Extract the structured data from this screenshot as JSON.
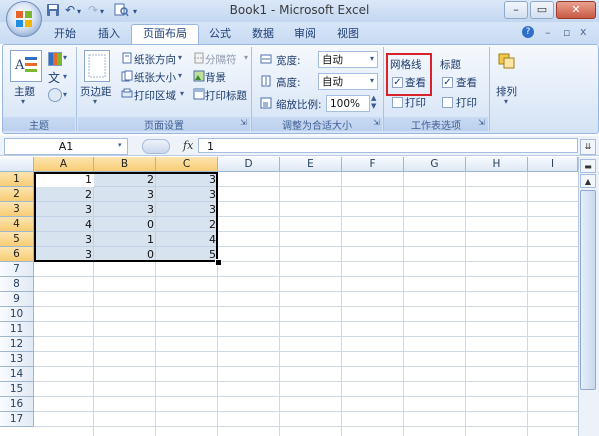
{
  "window": {
    "title": "Book1 - Microsoft Excel"
  },
  "tabs": [
    {
      "label": "开始"
    },
    {
      "label": "插入"
    },
    {
      "label": "页面布局"
    },
    {
      "label": "公式"
    },
    {
      "label": "数据"
    },
    {
      "label": "审阅"
    },
    {
      "label": "视图"
    }
  ],
  "ribbon": {
    "themes": {
      "label": "主题",
      "group": "主题"
    },
    "page_setup": {
      "margins": "页边距",
      "orientation": "纸张方向",
      "size": "纸张大小",
      "print_area": "打印区域",
      "breaks": "分隔符",
      "background": "背景",
      "print_titles": "打印标题",
      "group": "页面设置"
    },
    "scale": {
      "width_label": "宽度:",
      "width_value": "自动",
      "height_label": "高度:",
      "height_value": "自动",
      "scale_label": "缩放比例:",
      "scale_value": "100%",
      "group": "调整为合适大小"
    },
    "sheet_options": {
      "gridlines": "网格线",
      "headings": "标题",
      "view": "查看",
      "print": "打印",
      "group": "工作表选项"
    },
    "arrange": {
      "label": "排列"
    }
  },
  "formula_bar": {
    "name_box": "A1",
    "fx": "fx",
    "value": "1"
  },
  "columns": [
    "A",
    "B",
    "C",
    "D",
    "E",
    "F",
    "G",
    "H",
    "I"
  ],
  "rows": [
    "1",
    "2",
    "3",
    "4",
    "5",
    "6",
    "7",
    "8",
    "9",
    "10",
    "11",
    "12",
    "13",
    "14",
    "15",
    "16",
    "17"
  ],
  "cells": [
    [
      "1",
      "2",
      "3"
    ],
    [
      "2",
      "3",
      "3"
    ],
    [
      "3",
      "3",
      "3"
    ],
    [
      "4",
      "0",
      "2"
    ],
    [
      "3",
      "1",
      "4"
    ],
    [
      "3",
      "0",
      "5"
    ]
  ]
}
